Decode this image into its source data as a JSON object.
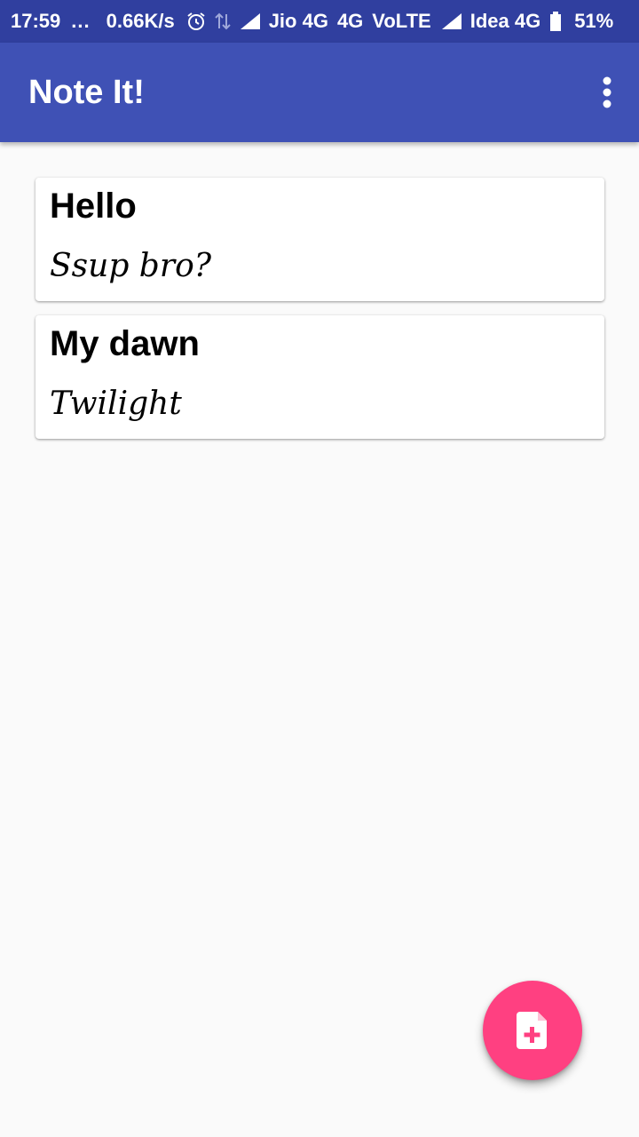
{
  "status_bar": {
    "time": "17:59",
    "dots": "...",
    "speed": "0.66K/s",
    "carrier1": "Jio 4G",
    "network": "4G",
    "volte": "VoLTE",
    "carrier2": "Idea 4G",
    "battery": "51%",
    "icons": [
      "alarm-icon",
      "data-arrows-icon",
      "signal-icon",
      "signal-icon",
      "battery-icon"
    ]
  },
  "app_bar": {
    "title": "Note It!",
    "menu_icon": "more-vertical-icon"
  },
  "notes": [
    {
      "title": "Hello",
      "body": "Ssup bro?"
    },
    {
      "title": "My dawn",
      "body": "Twilight"
    }
  ],
  "fab": {
    "icon": "add-note-icon"
  },
  "colors": {
    "status_bar": "#303f9f",
    "app_bar": "#3f51b5",
    "background": "#fafafa",
    "card": "#ffffff",
    "fab": "#ff4081"
  }
}
